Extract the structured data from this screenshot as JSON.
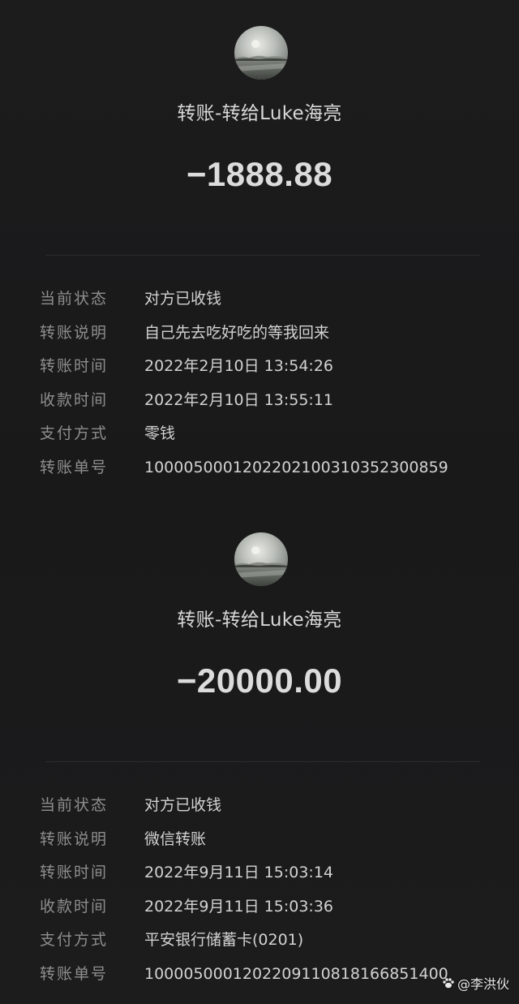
{
  "records": [
    {
      "title": "转账-转给Luke海亮",
      "amount": "−1888.88",
      "details": [
        {
          "label": "当前状态",
          "value": "对方已收钱"
        },
        {
          "label": "转账说明",
          "value": "自己先去吃好吃的等我回来"
        },
        {
          "label": "转账时间",
          "value": "2022年2月10日 13:54:26"
        },
        {
          "label": "收款时间",
          "value": "2022年2月10日 13:55:11"
        },
        {
          "label": "支付方式",
          "value": "零钱"
        },
        {
          "label": "转账单号",
          "value": "100005000120220210031035230085​9"
        }
      ]
    },
    {
      "title": "转账-转给Luke海亮",
      "amount": "−20000.00",
      "details": [
        {
          "label": "当前状态",
          "value": "对方已收钱"
        },
        {
          "label": "转账说明",
          "value": "微信转账"
        },
        {
          "label": "转账时间",
          "value": "2022年9月11日 15:03:14"
        },
        {
          "label": "收款时间",
          "value": "2022年9月11日 15:03:36"
        },
        {
          "label": "支付方式",
          "value": "平安银行储蓄卡(0201)"
        },
        {
          "label": "转账单号",
          "value": "1000050001202209110818166851400"
        }
      ]
    }
  ],
  "watermark": {
    "text": "@李洪伙",
    "icon": "paw-icon"
  },
  "colors": {
    "background": "#1b1b1c",
    "label": "#8e8e8e",
    "value": "#d2d2d2",
    "title": "#d8d8d8"
  }
}
